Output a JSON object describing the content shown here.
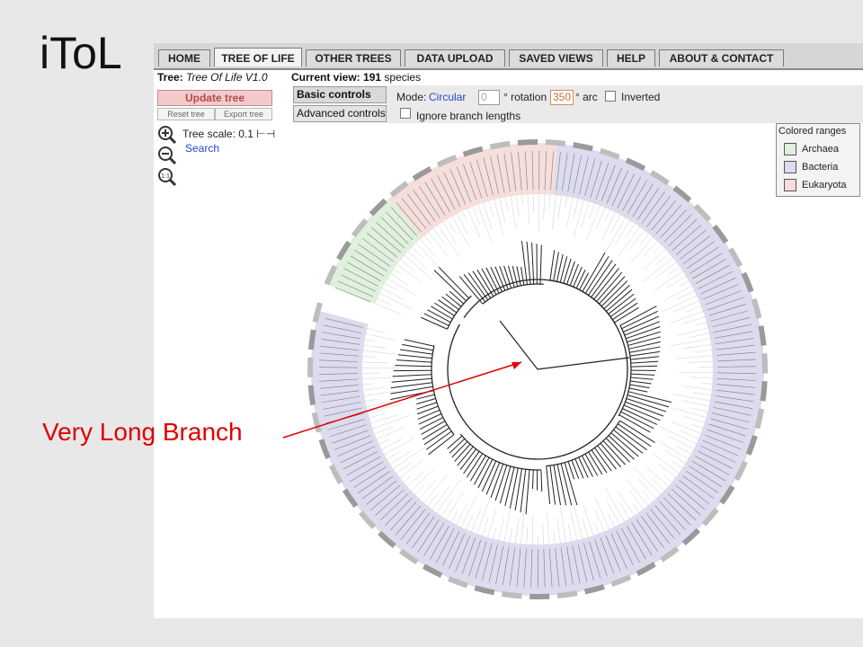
{
  "slide_title": "iToL",
  "annotation": "Very Long Branch",
  "colors": {
    "annotation": "#e00000",
    "archaea": "#dff0dc",
    "bacteria": "#dcdcee",
    "eukaryota": "#f6dedb"
  },
  "tabs": [
    "HOME",
    "TREE OF LIFE",
    "OTHER TREES",
    "DATA UPLOAD",
    "SAVED VIEWS",
    "HELP",
    "ABOUT & CONTACT"
  ],
  "active_tab": "TREE OF LIFE",
  "tree": {
    "label": "Tree:",
    "name": "Tree Of Life V1.0"
  },
  "current_view": {
    "label": "Current view:",
    "count": "191",
    "suffix": "species"
  },
  "buttons": {
    "update": "Update tree",
    "reset": "Reset tree",
    "export": "Export tree"
  },
  "controls": {
    "basic": "Basic controls",
    "advanced": "Advanced controls",
    "mode_label": "Mode:",
    "mode_value": "Circular",
    "rotation_value": "0",
    "rotation_label": "° rotation",
    "arc_value": "350",
    "arc_label": "° arc",
    "inverted_label": "Inverted",
    "ignore_label": "Ignore branch lengths"
  },
  "scale": {
    "label": "Tree scale:",
    "value": "0.1"
  },
  "search_label": "Search",
  "legend": {
    "title": "Colored ranges",
    "items": [
      {
        "label": "Archaea",
        "color": "#dff0dc"
      },
      {
        "label": "Bacteria",
        "color": "#dcdcee"
      },
      {
        "label": "Eukaryota",
        "color": "#f6dedb"
      }
    ]
  }
}
